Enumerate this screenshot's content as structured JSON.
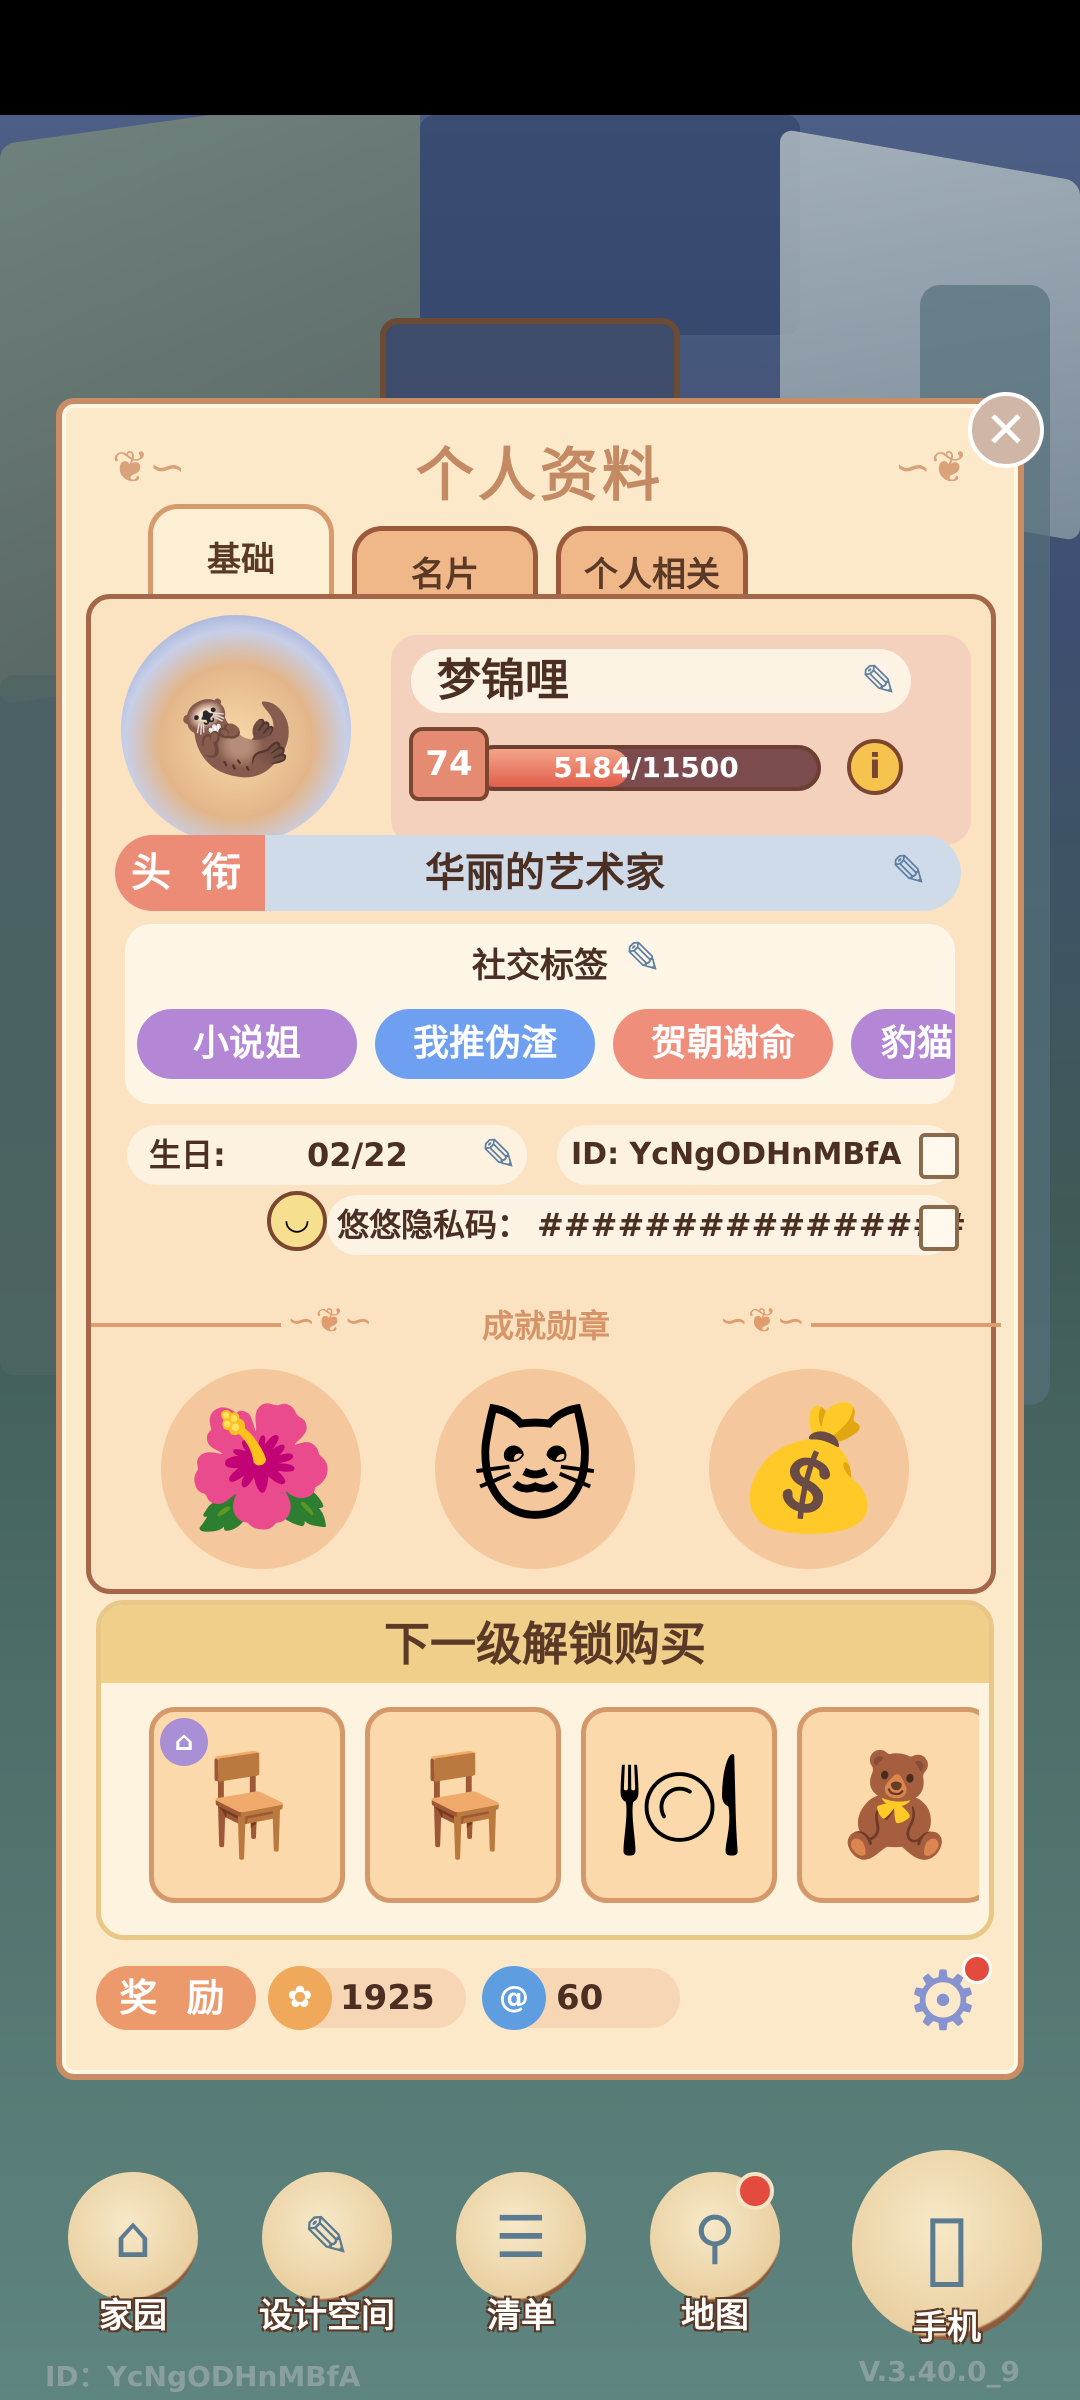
{
  "game": {
    "theme": "cozy home decoration"
  },
  "panel": {
    "title": "个人资料",
    "close_symbol": "✕",
    "tabs": [
      {
        "label": "基础",
        "active": true
      },
      {
        "label": "名片",
        "active": false
      },
      {
        "label": "个人相关",
        "active": false
      }
    ]
  },
  "profile": {
    "name": "梦锦哩",
    "level": "74",
    "xp_text": "5184/11500",
    "xp_fraction": 0.45,
    "info_symbol": "i",
    "title_label": "头 衔",
    "title_value": "华丽的艺术家"
  },
  "social": {
    "title": "社交标签",
    "tags": [
      {
        "label": "小说姐",
        "color": "#b387d6"
      },
      {
        "label": "我推伪渣",
        "color": "#6f9ff0"
      },
      {
        "label": "贺朝谢俞",
        "color": "#ef8e7a"
      },
      {
        "label": "豹猫",
        "color": "#b387d6"
      }
    ]
  },
  "details": {
    "birthday_label": "生日:",
    "birthday_value": "02/22",
    "id_text": "ID: YcNgODHnMBfA",
    "privacy_label": "悠悠隐私码：",
    "privacy_value": "################"
  },
  "achievements": {
    "title": "成就勋章",
    "medals": [
      {
        "name": "flower-pot-medal",
        "icon": "🌺"
      },
      {
        "name": "hello-kitty-medal",
        "icon": "🐱"
      },
      {
        "name": "money-bag-medal",
        "icon": "💰"
      }
    ]
  },
  "unlock": {
    "title": "下一级解锁购买",
    "items": [
      {
        "name": "pink-chair",
        "icon": "🪑",
        "badge": "⌂"
      },
      {
        "name": "wood-chair",
        "icon": "🪑"
      },
      {
        "name": "round-table",
        "icon": "🍽"
      },
      {
        "name": "bear-plush",
        "icon": "🧸"
      }
    ]
  },
  "rewards": {
    "label": "奖 励",
    "coins": "1925",
    "gems": "60",
    "coin_color": "#f0a85a",
    "gem_color": "#5d9de0"
  },
  "nav": {
    "items": [
      {
        "label": "家园",
        "icon": "⌂"
      },
      {
        "label": "设计空间",
        "icon": "✎"
      },
      {
        "label": "清单",
        "icon": "☰"
      },
      {
        "label": "地图",
        "icon": "⚲"
      },
      {
        "label": "手机",
        "icon": "▯"
      }
    ]
  },
  "footer": {
    "id_text": "ID：YcNgODHnMBfA",
    "version": "V.3.40.0_9"
  }
}
